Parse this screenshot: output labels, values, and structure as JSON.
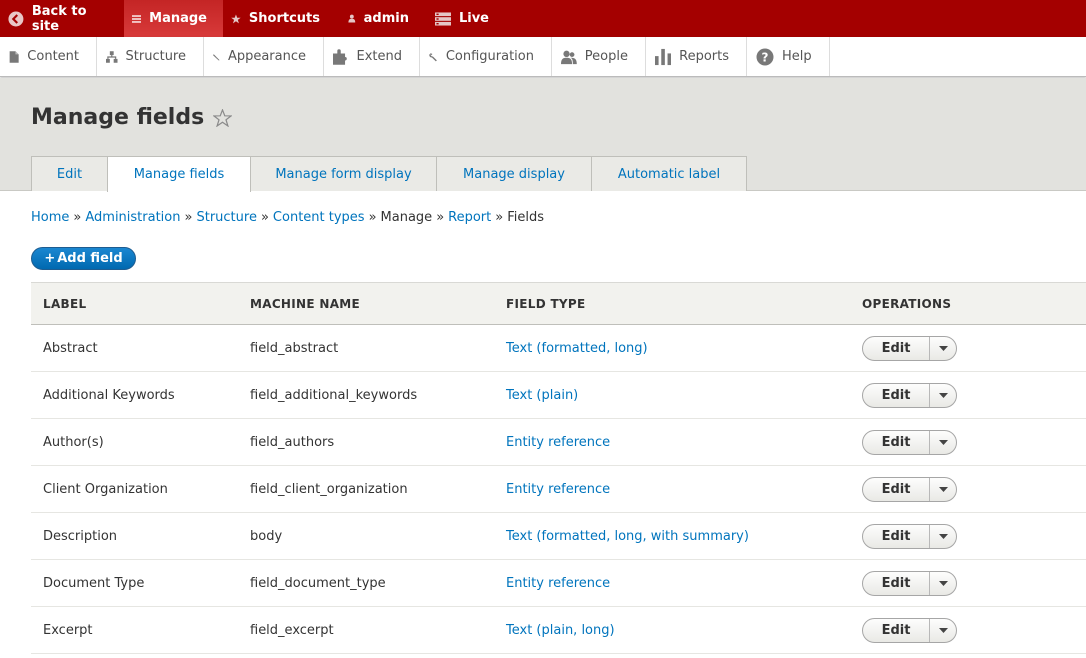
{
  "toolbar": {
    "items": [
      {
        "label": "Back to site",
        "icon": "back-arrow-icon"
      },
      {
        "label": "Manage",
        "icon": "hamburger-menu-icon"
      },
      {
        "label": "Shortcuts",
        "icon": "star-icon"
      },
      {
        "label": "admin",
        "icon": "user-icon"
      },
      {
        "label": "Live",
        "icon": "workspace-icon"
      }
    ]
  },
  "tray": {
    "items": [
      {
        "label": "Content",
        "icon": "page-icon"
      },
      {
        "label": "Structure",
        "icon": "structure-icon"
      },
      {
        "label": "Appearance",
        "icon": "paintbrush-icon"
      },
      {
        "label": "Extend",
        "icon": "puzzle-icon"
      },
      {
        "label": "Configuration",
        "icon": "wrench-icon"
      },
      {
        "label": "People",
        "icon": "people-icon"
      },
      {
        "label": "Reports",
        "icon": "bar-chart-icon"
      },
      {
        "label": "Help",
        "icon": "help-icon"
      }
    ]
  },
  "page": {
    "title": "Manage fields"
  },
  "tabs": [
    {
      "label": "Edit"
    },
    {
      "label": "Manage fields"
    },
    {
      "label": "Manage form display"
    },
    {
      "label": "Manage display"
    },
    {
      "label": "Automatic label"
    }
  ],
  "breadcrumb": {
    "home": "Home",
    "administration": "Administration",
    "structure": "Structure",
    "content_types": "Content types",
    "manage": "Manage",
    "report": "Report",
    "fields": "Fields",
    "separator": "»"
  },
  "add_field": {
    "label": "Add field"
  },
  "table": {
    "headers": {
      "label": "LABEL",
      "machine_name": "MACHINE NAME",
      "field_type": "FIELD TYPE",
      "operations": "OPERATIONS"
    },
    "rows": [
      {
        "label": "Abstract",
        "machine_name": "field_abstract",
        "field_type": "Text (formatted, long)",
        "op": "Edit"
      },
      {
        "label": "Additional Keywords",
        "machine_name": "field_additional_keywords",
        "field_type": "Text (plain)",
        "op": "Edit"
      },
      {
        "label": "Author(s)",
        "machine_name": "field_authors",
        "field_type": "Entity reference",
        "op": "Edit"
      },
      {
        "label": "Client Organization",
        "machine_name": "field_client_organization",
        "field_type": "Entity reference",
        "op": "Edit"
      },
      {
        "label": "Description",
        "machine_name": "body",
        "field_type": "Text (formatted, long, with summary)",
        "op": "Edit"
      },
      {
        "label": "Document Type",
        "machine_name": "field_document_type",
        "field_type": "Entity reference",
        "op": "Edit"
      },
      {
        "label": "Excerpt",
        "machine_name": "field_excerpt",
        "field_type": "Text (plain, long)",
        "op": "Edit"
      }
    ]
  },
  "colors": {
    "toolbar_bg": "#a40000",
    "toolbar_active": "#d23030",
    "link": "#0074bd",
    "header_bg": "#e2e2de",
    "primary_button": "#0071b8"
  }
}
